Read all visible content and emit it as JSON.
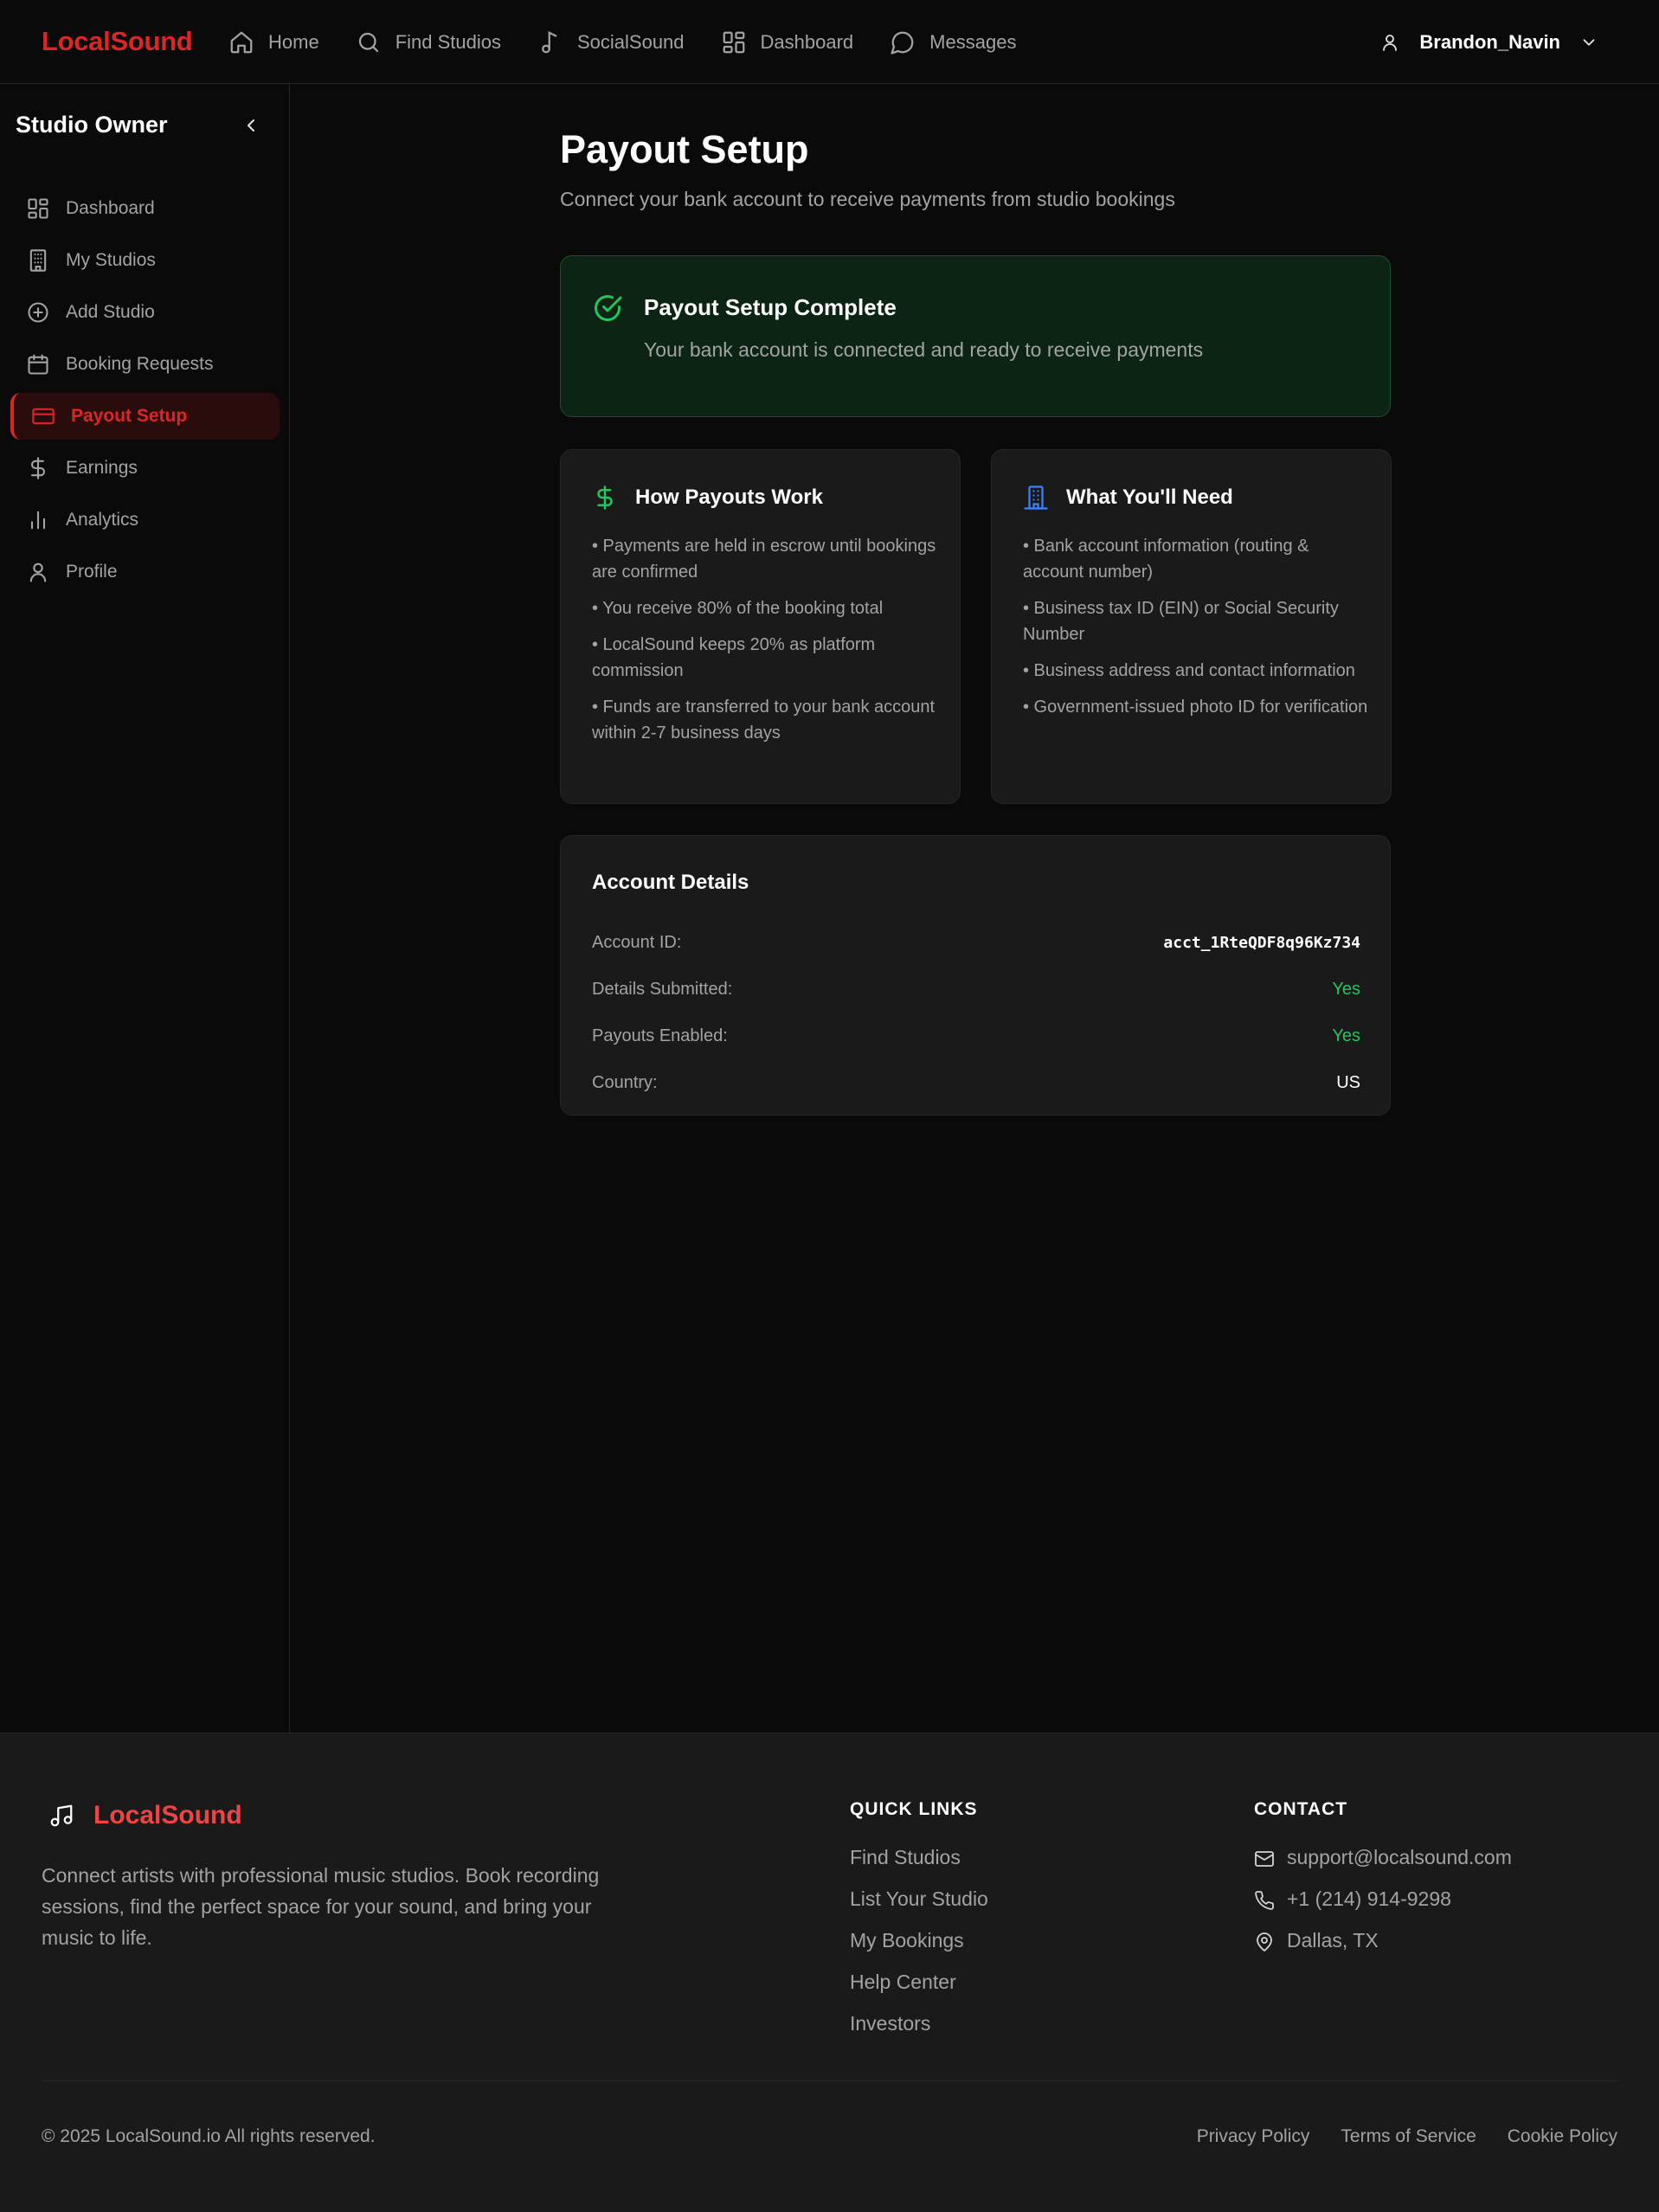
{
  "brand": {
    "name": "LocalSound",
    "accent": "#dc2626"
  },
  "nav": {
    "items": [
      {
        "label": "Home",
        "icon": "home-icon"
      },
      {
        "label": "Find Studios",
        "icon": "search-icon"
      },
      {
        "label": "SocialSound",
        "icon": "music-note-icon"
      },
      {
        "label": "Dashboard",
        "icon": "dashboard-icon"
      },
      {
        "label": "Messages",
        "icon": "message-icon"
      }
    ],
    "user": {
      "name": "Brandon_Navin",
      "icon": "user-icon"
    }
  },
  "sidebar": {
    "title": "Studio Owner",
    "items": [
      {
        "label": "Dashboard",
        "icon": "dashboard-icon"
      },
      {
        "label": "My Studios",
        "icon": "building-icon"
      },
      {
        "label": "Add Studio",
        "icon": "plus-circle-icon"
      },
      {
        "label": "Booking Requests",
        "icon": "calendar-icon"
      },
      {
        "label": "Payout Setup",
        "icon": "credit-card-icon",
        "active": true
      },
      {
        "label": "Earnings",
        "icon": "dollar-icon"
      },
      {
        "label": "Analytics",
        "icon": "bar-chart-icon"
      },
      {
        "label": "Profile",
        "icon": "user-icon"
      }
    ]
  },
  "main": {
    "title": "Payout Setup",
    "subtitle": "Connect your bank account to receive payments from studio bookings",
    "status": {
      "title": "Payout Setup Complete",
      "text": "Your bank account is connected and ready to receive payments",
      "color": "#22c55e"
    },
    "how": {
      "title": "How Payouts Work",
      "items": [
        "• Payments are held in escrow until bookings are confirmed",
        "• You receive 80% of the booking total",
        "• LocalSound keeps 20% as platform commission",
        "• Funds are transferred to your bank account within 2-7 business days"
      ]
    },
    "need": {
      "title": "What You'll Need",
      "items": [
        "• Bank account information (routing & account number)",
        "• Business tax ID (EIN) or Social Security Number",
        "• Business address and contact information",
        "• Government-issued photo ID for verification"
      ]
    },
    "details": {
      "title": "Account Details",
      "rows": [
        {
          "label": "Account ID:",
          "value": "acct_1RteQDF8q96Kz734"
        },
        {
          "label": "Details Submitted:",
          "value": "Yes"
        },
        {
          "label": "Payouts Enabled:",
          "value": "Yes"
        },
        {
          "label": "Country:",
          "value": "US"
        }
      ]
    }
  },
  "footer": {
    "brand": "LocalSound",
    "description": "Connect artists with professional music studios. Book recording sessions, find the perfect space for your sound, and bring your music to life.",
    "quick_links": {
      "title": "QUICK LINKS",
      "items": [
        "Find Studios",
        "List Your Studio",
        "My Bookings",
        "Help Center",
        "Investors"
      ]
    },
    "contact": {
      "title": "CONTACT",
      "email": "support@localsound.com",
      "phone": "+1 (214) 914-9298",
      "location": "Dallas, TX"
    },
    "copyright": "© 2025 LocalSound.io All rights reserved.",
    "legal": [
      "Privacy Policy",
      "Terms of Service",
      "Cookie Policy"
    ]
  }
}
